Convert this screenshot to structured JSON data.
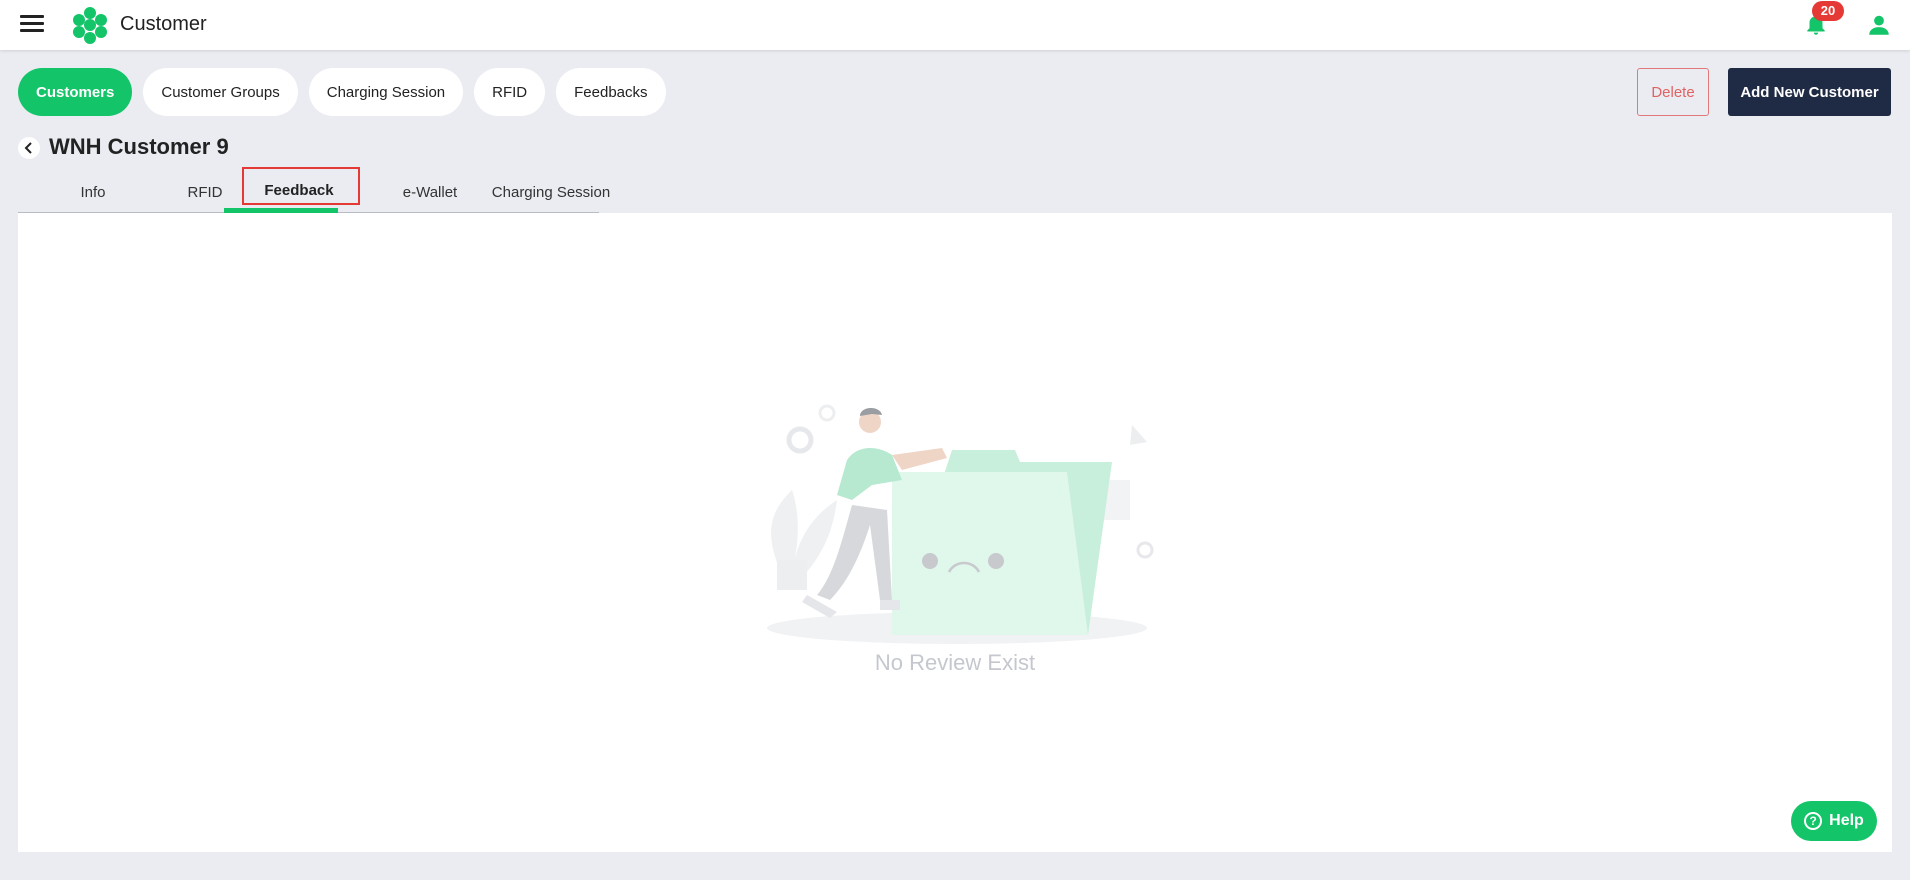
{
  "header": {
    "title": "Customer",
    "notification_count": "20",
    "icons": [
      "menu-icon",
      "logo-icon",
      "bell-icon",
      "user-icon"
    ]
  },
  "nav_pills": [
    "Customers",
    "Customer Groups",
    "Charging Session",
    "RFID",
    "Feedbacks"
  ],
  "active_pill": "Customers",
  "actions": {
    "delete_label": "Delete",
    "add_label": "Add New Customer"
  },
  "page": {
    "title": "WNH Customer 9"
  },
  "tabs": [
    "Info",
    "RFID",
    "Feedback",
    "e-Wallet",
    "Charging Session"
  ],
  "active_tab": "Feedback",
  "empty_state": {
    "message": "No Review Exist"
  },
  "help": {
    "label": "Help",
    "icon_glyph": "?"
  },
  "colors": {
    "accent": "#13c468",
    "dark_button": "#1f2a44",
    "danger": "#e53935",
    "background": "#eaecf1"
  }
}
